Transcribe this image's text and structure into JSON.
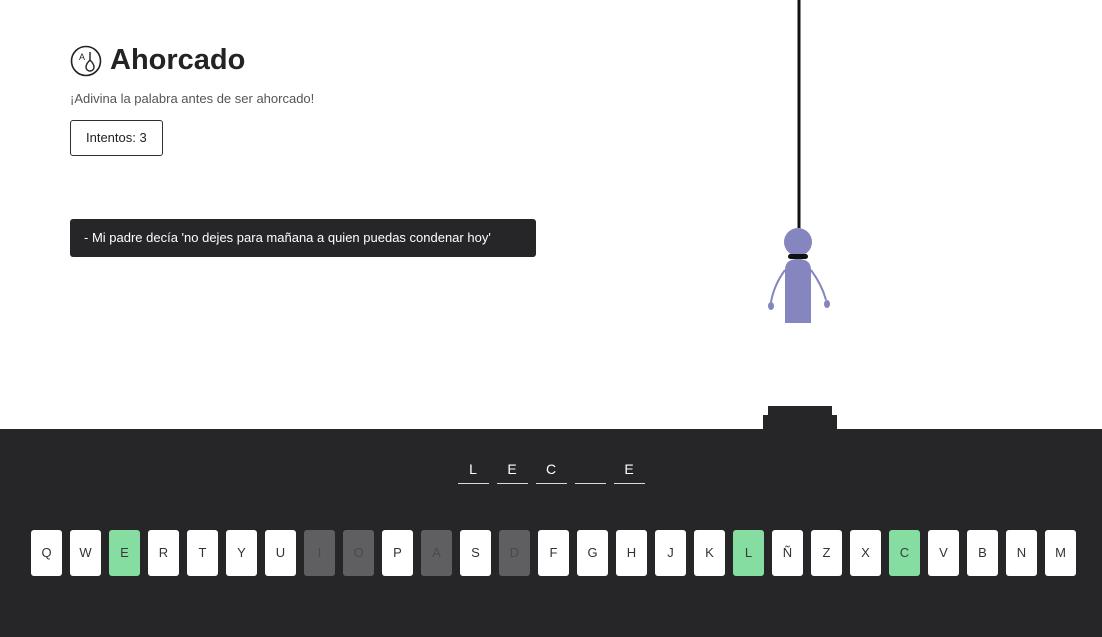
{
  "header": {
    "title": "Ahorcado",
    "subtitle": "¡Adivina la palabra antes de ser ahorcado!",
    "tries_label": "Intentos: 3"
  },
  "hint": "- Mi padre decía 'no dejes para mañana a quien puedas condenar hoy'",
  "word": [
    "L",
    "E",
    "C",
    "",
    "E"
  ],
  "keyboard": [
    {
      "k": "Q",
      "s": "unused"
    },
    {
      "k": "W",
      "s": "unused"
    },
    {
      "k": "E",
      "s": "correct"
    },
    {
      "k": "R",
      "s": "unused"
    },
    {
      "k": "T",
      "s": "unused"
    },
    {
      "k": "Y",
      "s": "unused"
    },
    {
      "k": "U",
      "s": "unused"
    },
    {
      "k": "I",
      "s": "wrong"
    },
    {
      "k": "O",
      "s": "wrong"
    },
    {
      "k": "P",
      "s": "unused"
    },
    {
      "k": "A",
      "s": "wrong"
    },
    {
      "k": "S",
      "s": "unused"
    },
    {
      "k": "D",
      "s": "wrong"
    },
    {
      "k": "F",
      "s": "unused"
    },
    {
      "k": "G",
      "s": "unused"
    },
    {
      "k": "H",
      "s": "unused"
    },
    {
      "k": "J",
      "s": "unused"
    },
    {
      "k": "K",
      "s": "unused"
    },
    {
      "k": "L",
      "s": "correct"
    },
    {
      "k": "Ñ",
      "s": "unused"
    },
    {
      "k": "Z",
      "s": "unused"
    },
    {
      "k": "X",
      "s": "unused"
    },
    {
      "k": "C",
      "s": "correct"
    },
    {
      "k": "V",
      "s": "unused"
    },
    {
      "k": "B",
      "s": "unused"
    },
    {
      "k": "N",
      "s": "unused"
    },
    {
      "k": "M",
      "s": "unused"
    }
  ],
  "colors": {
    "correct": "#86dda1",
    "wrong": "#5f5f61",
    "dark": "#262629",
    "figure": "#8585bf"
  }
}
